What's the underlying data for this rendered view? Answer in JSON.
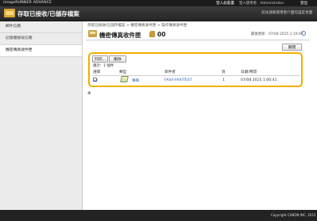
{
  "header": {
    "brand": "imageRUNNER ADVANCE",
    "login_label": "登入此裝置",
    "user_label": "登入使用者：Administrator",
    "logout_label": "登出"
  },
  "titlebar": {
    "title": "存取已接收/已儲存檔案",
    "settings_link": "前往遠端使用者介面的設定頁面"
  },
  "sidebar": {
    "items": [
      {
        "label": "郵件信箱"
      },
      {
        "label": "記憶體接收信箱"
      },
      {
        "label": "機密傳真收件匣"
      }
    ]
  },
  "main": {
    "breadcrumb": "存取已接收/已儲存檔案 > 機密傳真收件匣 > 操作傳真收件匣",
    "title": "機密傳真收件匣",
    "box_number": "00",
    "last_updated": "最後更新：07/08 2015 1:10:07",
    "close_button": "關閉",
    "print_button": "列印...",
    "delete_button": "刪除",
    "selection_summary": "總計：1 個件",
    "columns": {
      "select": "選擇",
      "type": "類型",
      "sender": "寄件者",
      "pages": "頁",
      "datetime": "日期/時間"
    },
    "rows": [
      {
        "selected": true,
        "type": "傳真",
        "sender": "FAX/I-FAX/TEST",
        "pages": "1",
        "datetime": "07/08 2015 1:00:41"
      }
    ],
    "footer_mark": "本"
  },
  "footer": {
    "copyright": "Copyright CANON INC. 2015"
  },
  "colors": {
    "highlight": "#f0b000",
    "link": "#2a5db0",
    "topbar": "#1c1c1c"
  }
}
